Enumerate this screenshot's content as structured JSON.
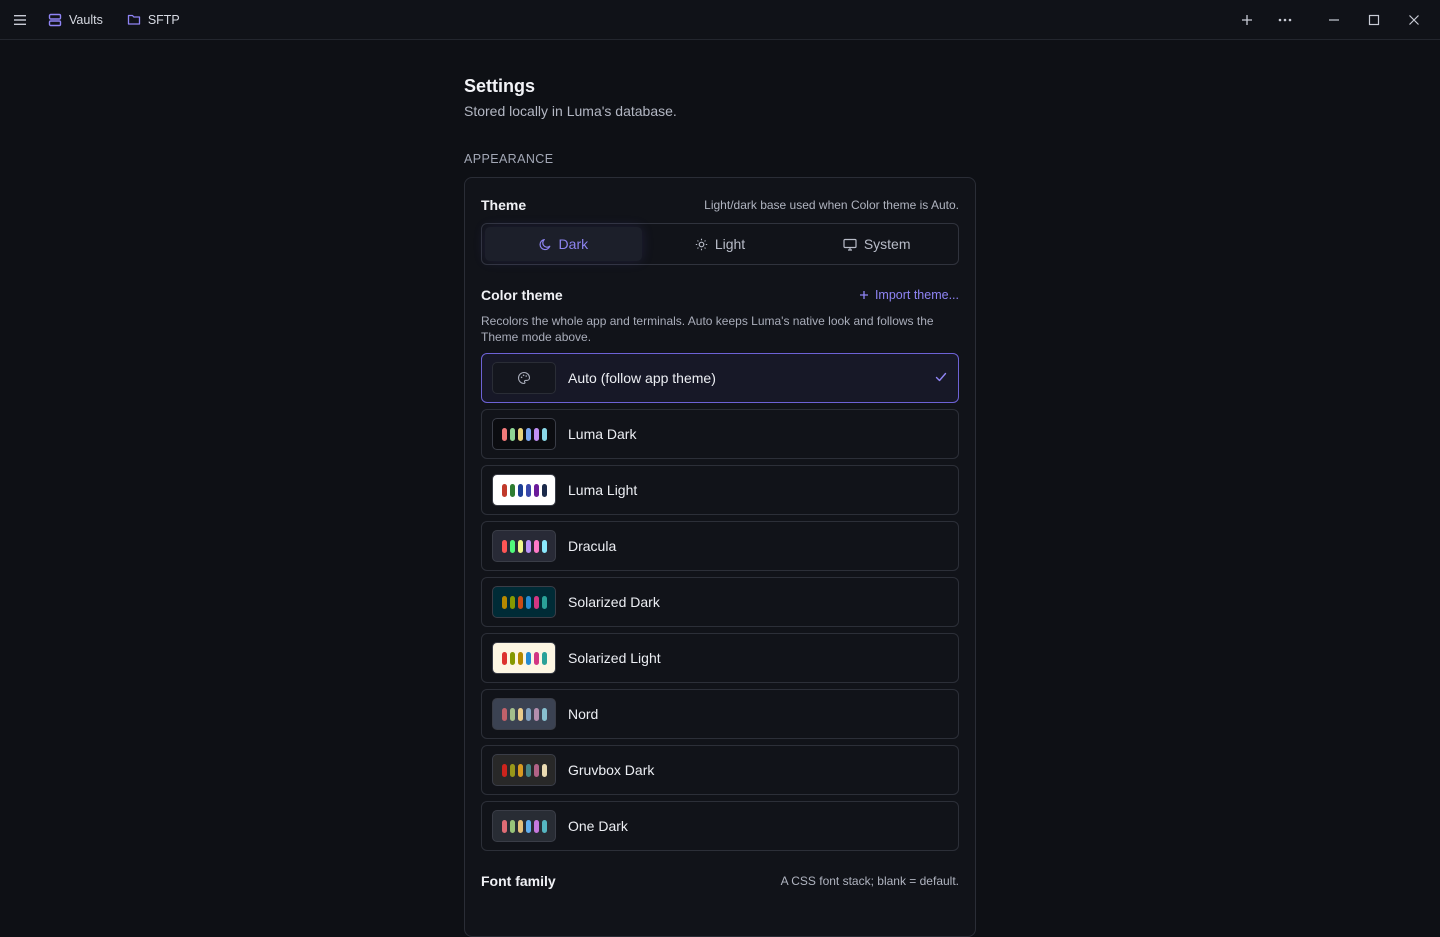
{
  "titlebar": {
    "tabs": [
      {
        "label": "Vaults",
        "icon": "server-stack-icon"
      },
      {
        "label": "SFTP",
        "icon": "folder-icon"
      }
    ]
  },
  "page": {
    "title": "Settings",
    "subtitle": "Stored locally in Luma's database."
  },
  "appearance": {
    "section_label": "APPEARANCE",
    "theme": {
      "title": "Theme",
      "hint": "Light/dark base used when Color theme is Auto.",
      "options": [
        {
          "label": "Dark",
          "icon": "moon-icon",
          "active": true
        },
        {
          "label": "Light",
          "icon": "sun-icon",
          "active": false
        },
        {
          "label": "System",
          "icon": "monitor-icon",
          "active": false
        }
      ]
    },
    "color_theme": {
      "title": "Color theme",
      "import_label": "Import theme...",
      "description": "Recolors the whole app and terminals. Auto keeps Luma's native look and follows the Theme mode above.",
      "themes": [
        {
          "name": "Auto (follow app theme)",
          "selected": true,
          "bg": "#14161e",
          "colors": []
        },
        {
          "name": "Luma Dark",
          "selected": false,
          "bg": "#0b0c10",
          "colors": [
            "#f27a7a",
            "#8fd694",
            "#e8d27a",
            "#7aa7f2",
            "#c08ef2",
            "#8ad8e8"
          ]
        },
        {
          "name": "Luma Light",
          "selected": false,
          "bg": "#ffffff",
          "colors": [
            "#c0392b",
            "#2e7d32",
            "#1c3f95",
            "#3949ab",
            "#6a1b9a",
            "#1b2a4a"
          ]
        },
        {
          "name": "Dracula",
          "selected": false,
          "bg": "#282a36",
          "colors": [
            "#ff5555",
            "#50fa7b",
            "#f1fa8c",
            "#bd93f9",
            "#ff79c6",
            "#8be9fd"
          ]
        },
        {
          "name": "Solarized Dark",
          "selected": false,
          "bg": "#002b36",
          "colors": [
            "#b58900",
            "#859900",
            "#cb4b16",
            "#268bd2",
            "#d33682",
            "#2aa198"
          ]
        },
        {
          "name": "Solarized Light",
          "selected": false,
          "bg": "#fdf6e3",
          "colors": [
            "#dc322f",
            "#859900",
            "#b58900",
            "#268bd2",
            "#d33682",
            "#2aa198"
          ]
        },
        {
          "name": "Nord",
          "selected": false,
          "bg": "#3b4252",
          "colors": [
            "#bf616a",
            "#a3be8c",
            "#ebcb8b",
            "#81a1c1",
            "#b48ead",
            "#88c0d0"
          ]
        },
        {
          "name": "Gruvbox Dark",
          "selected": false,
          "bg": "#282828",
          "colors": [
            "#cc241d",
            "#98971a",
            "#d79921",
            "#458588",
            "#b16286",
            "#ebdbb2"
          ]
        },
        {
          "name": "One Dark",
          "selected": false,
          "bg": "#282c34",
          "colors": [
            "#e06c75",
            "#98c379",
            "#e5c07b",
            "#61afef",
            "#c678dd",
            "#56b6c2"
          ]
        }
      ]
    },
    "font_family": {
      "title": "Font family",
      "hint": "A CSS font stack; blank = default."
    }
  },
  "colors": {
    "accent": "#8f84f5",
    "background": "#0e1015",
    "card": "#111319",
    "border": "#2a2d36"
  }
}
